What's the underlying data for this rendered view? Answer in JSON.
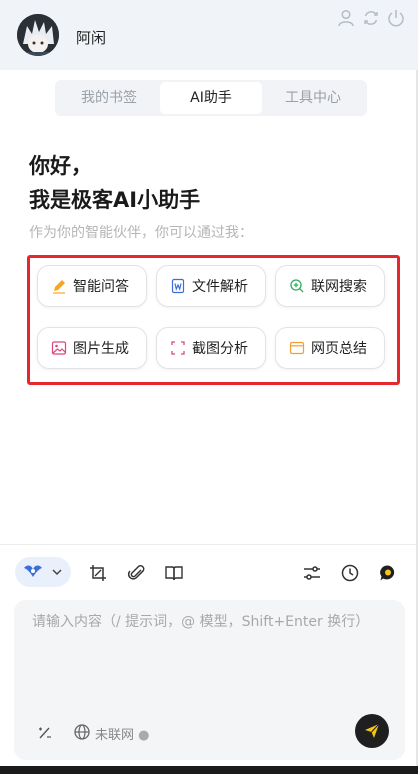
{
  "header": {
    "username": "阿闲",
    "icons": [
      "user-icon",
      "sync-icon",
      "power-icon"
    ]
  },
  "tabs": [
    {
      "label": "我的书签",
      "active": false
    },
    {
      "label": "AI助手",
      "active": true
    },
    {
      "label": "工具中心",
      "active": false
    }
  ],
  "greeting": {
    "line1": "你好，",
    "line2": "我是极客AI小助手",
    "subtitle": "作为你的智能伙伴，你可以通过我："
  },
  "features": [
    {
      "label": "智能问答",
      "icon": "pencil-icon"
    },
    {
      "label": "文件解析",
      "icon": "word-doc-icon"
    },
    {
      "label": "联网搜索",
      "icon": "search-plus-icon"
    },
    {
      "label": "图片生成",
      "icon": "image-icon"
    },
    {
      "label": "截图分析",
      "icon": "screenshot-icon"
    },
    {
      "label": "网页总结",
      "icon": "webpage-icon"
    }
  ],
  "toolbar": {
    "icons": [
      "model-select-icon",
      "crop-icon",
      "attachment-icon",
      "book-icon",
      "settings-sliders-icon",
      "history-icon",
      "new-chat-icon"
    ]
  },
  "input": {
    "placeholder": "请输入内容（/ 提示词，@ 模型，Shift+Enter 换行）",
    "network_status": "未联网"
  },
  "colors": {
    "accent": "#f5c518",
    "highlight_box": "#e8262f",
    "model_blue": "#3b6fd6"
  }
}
